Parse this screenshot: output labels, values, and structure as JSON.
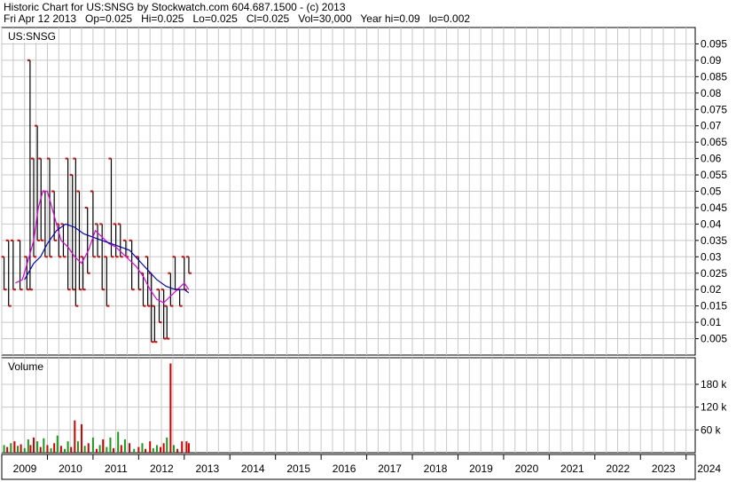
{
  "header": {
    "line1": "Historic Chart for US:SNSG by Stockwatch.com 604.687.1500 - (c) 2013",
    "line2": "Fri Apr 12 2013   Op=0.025   Hi=0.025   Lo=0.025   Cl=0.025   Vol=30,000   Year hi=0.09   lo=0.002"
  },
  "colors": {
    "background": "#ffffff",
    "grid": "#c8c8c8",
    "price_bar": "#000000",
    "price_tick": "#e00000",
    "ma_fast": "#e000e0",
    "ma_slow": "#0000c8",
    "volume_up": "#1a9a1a",
    "volume_down": "#d00000"
  },
  "chart_data": [
    {
      "type": "line",
      "title": "US:SNSG",
      "y_ticks": [
        "0.095",
        "0.09",
        "0.085",
        "0.08",
        "0.075",
        "0.07",
        "0.065",
        "0.06",
        "0.055",
        "0.05",
        "0.045",
        "0.04",
        "0.035",
        "0.03",
        "0.025",
        "0.02",
        "0.015",
        "0.01",
        "0.005"
      ],
      "ylim": [
        0,
        0.1
      ],
      "x_ticks": [
        "2009",
        "2010",
        "2011",
        "2012",
        "2013",
        "2014",
        "2015",
        "2016",
        "2017",
        "2018",
        "2019",
        "2020",
        "2021",
        "2022",
        "2023",
        "2024"
      ],
      "xlim": [
        2009,
        2024.2
      ],
      "grid": true,
      "price_bars": [
        {
          "x": 2009.05,
          "hi": 0.03,
          "lo": 0.02
        },
        {
          "x": 2009.15,
          "hi": 0.035,
          "lo": 0.015
        },
        {
          "x": 2009.25,
          "hi": 0.035,
          "lo": 0.02
        },
        {
          "x": 2009.4,
          "hi": 0.035,
          "lo": 0.02
        },
        {
          "x": 2009.55,
          "hi": 0.03,
          "lo": 0.02
        },
        {
          "x": 2009.62,
          "hi": 0.09,
          "lo": 0.02
        },
        {
          "x": 2009.7,
          "hi": 0.06,
          "lo": 0.03
        },
        {
          "x": 2009.78,
          "hi": 0.07,
          "lo": 0.035
        },
        {
          "x": 2009.86,
          "hi": 0.06,
          "lo": 0.035
        },
        {
          "x": 2009.95,
          "hi": 0.05,
          "lo": 0.03
        },
        {
          "x": 2010.05,
          "hi": 0.06,
          "lo": 0.03
        },
        {
          "x": 2010.15,
          "hi": 0.05,
          "lo": 0.035
        },
        {
          "x": 2010.25,
          "hi": 0.04,
          "lo": 0.03
        },
        {
          "x": 2010.35,
          "hi": 0.04,
          "lo": 0.03
        },
        {
          "x": 2010.45,
          "hi": 0.06,
          "lo": 0.02
        },
        {
          "x": 2010.55,
          "hi": 0.055,
          "lo": 0.02
        },
        {
          "x": 2010.62,
          "hi": 0.06,
          "lo": 0.015
        },
        {
          "x": 2010.7,
          "hi": 0.05,
          "lo": 0.02
        },
        {
          "x": 2010.78,
          "hi": 0.03,
          "lo": 0.02
        },
        {
          "x": 2010.88,
          "hi": 0.045,
          "lo": 0.025
        },
        {
          "x": 2011.0,
          "hi": 0.05,
          "lo": 0.03
        },
        {
          "x": 2011.1,
          "hi": 0.04,
          "lo": 0.03
        },
        {
          "x": 2011.2,
          "hi": 0.04,
          "lo": 0.02
        },
        {
          "x": 2011.3,
          "hi": 0.03,
          "lo": 0.015
        },
        {
          "x": 2011.4,
          "hi": 0.06,
          "lo": 0.03
        },
        {
          "x": 2011.5,
          "hi": 0.04,
          "lo": 0.03
        },
        {
          "x": 2011.6,
          "hi": 0.04,
          "lo": 0.03
        },
        {
          "x": 2011.72,
          "hi": 0.035,
          "lo": 0.03
        },
        {
          "x": 2011.85,
          "hi": 0.035,
          "lo": 0.02
        },
        {
          "x": 2012.0,
          "hi": 0.03,
          "lo": 0.02
        },
        {
          "x": 2012.1,
          "hi": 0.025,
          "lo": 0.015
        },
        {
          "x": 2012.2,
          "hi": 0.03,
          "lo": 0.015
        },
        {
          "x": 2012.28,
          "hi": 0.025,
          "lo": 0.004
        },
        {
          "x": 2012.35,
          "hi": 0.015,
          "lo": 0.004
        },
        {
          "x": 2012.45,
          "hi": 0.02,
          "lo": 0.01
        },
        {
          "x": 2012.55,
          "hi": 0.02,
          "lo": 0.005
        },
        {
          "x": 2012.62,
          "hi": 0.015,
          "lo": 0.005
        },
        {
          "x": 2012.7,
          "hi": 0.025,
          "lo": 0.015
        },
        {
          "x": 2012.8,
          "hi": 0.03,
          "lo": 0.02
        },
        {
          "x": 2012.9,
          "hi": 0.02,
          "lo": 0.015
        },
        {
          "x": 2013.0,
          "hi": 0.03,
          "lo": 0.02
        },
        {
          "x": 2013.1,
          "hi": 0.03,
          "lo": 0.025
        }
      ],
      "series": [
        {
          "values_x": [
            2009.3,
            2009.45,
            2009.6,
            2009.7,
            2009.8,
            2009.9,
            2010.0,
            2010.1,
            2010.2,
            2010.3,
            2010.45,
            2010.6,
            2010.75,
            2010.9,
            2011.05,
            2011.2,
            2011.35,
            2011.5,
            2011.65,
            2011.8,
            2011.95,
            2012.1,
            2012.25,
            2012.4,
            2012.55,
            2012.7,
            2012.85,
            2013.0,
            2013.1
          ],
          "values_y": [
            0.022,
            0.023,
            0.03,
            0.035,
            0.045,
            0.05,
            0.05,
            0.045,
            0.04,
            0.035,
            0.033,
            0.03,
            0.028,
            0.032,
            0.038,
            0.036,
            0.034,
            0.033,
            0.031,
            0.029,
            0.027,
            0.024,
            0.02,
            0.017,
            0.016,
            0.018,
            0.02,
            0.022,
            0.02
          ]
        },
        {
          "values_x": [
            2009.5,
            2009.7,
            2009.85,
            2010.0,
            2010.2,
            2010.4,
            2010.6,
            2010.8,
            2011.0,
            2011.2,
            2011.4,
            2011.6,
            2011.8,
            2012.0,
            2012.2,
            2012.4,
            2012.6,
            2012.8,
            2013.0,
            2013.1
          ],
          "values_y": [
            0.023,
            0.028,
            0.03,
            0.034,
            0.038,
            0.04,
            0.039,
            0.037,
            0.036,
            0.035,
            0.034,
            0.033,
            0.032,
            0.029,
            0.026,
            0.023,
            0.021,
            0.02,
            0.02,
            0.019
          ]
        }
      ]
    },
    {
      "type": "bar",
      "title": "Volume",
      "y_ticks": [
        "180 k",
        "120 k",
        "60 k"
      ],
      "ylim": [
        0,
        250000
      ],
      "bars": [
        {
          "x": 2009.05,
          "v": 20000,
          "up": true
        },
        {
          "x": 2009.12,
          "v": 15000,
          "up": false
        },
        {
          "x": 2009.2,
          "v": 25000,
          "up": true
        },
        {
          "x": 2009.28,
          "v": 30000,
          "up": false
        },
        {
          "x": 2009.35,
          "v": 18000,
          "up": true
        },
        {
          "x": 2009.42,
          "v": 22000,
          "up": false
        },
        {
          "x": 2009.5,
          "v": 12000,
          "up": true
        },
        {
          "x": 2009.58,
          "v": 35000,
          "up": true
        },
        {
          "x": 2009.63,
          "v": 20000,
          "up": false
        },
        {
          "x": 2009.7,
          "v": 40000,
          "up": false
        },
        {
          "x": 2009.78,
          "v": 30000,
          "up": true
        },
        {
          "x": 2009.85,
          "v": 15000,
          "up": false
        },
        {
          "x": 2009.92,
          "v": 38000,
          "up": true
        },
        {
          "x": 2010.0,
          "v": 20000,
          "up": false
        },
        {
          "x": 2010.08,
          "v": 12000,
          "up": true
        },
        {
          "x": 2010.15,
          "v": 25000,
          "up": false
        },
        {
          "x": 2010.22,
          "v": 45000,
          "up": true
        },
        {
          "x": 2010.3,
          "v": 18000,
          "up": false
        },
        {
          "x": 2010.38,
          "v": 10000,
          "up": true
        },
        {
          "x": 2010.45,
          "v": 30000,
          "up": true
        },
        {
          "x": 2010.52,
          "v": 15000,
          "up": false
        },
        {
          "x": 2010.6,
          "v": 85000,
          "up": false
        },
        {
          "x": 2010.67,
          "v": 30000,
          "up": true
        },
        {
          "x": 2010.75,
          "v": 75000,
          "up": false
        },
        {
          "x": 2010.82,
          "v": 18000,
          "up": true
        },
        {
          "x": 2010.9,
          "v": 25000,
          "up": false
        },
        {
          "x": 2011.0,
          "v": 40000,
          "up": true
        },
        {
          "x": 2011.08,
          "v": 10000,
          "up": false
        },
        {
          "x": 2011.15,
          "v": 20000,
          "up": true
        },
        {
          "x": 2011.22,
          "v": 35000,
          "up": false
        },
        {
          "x": 2011.3,
          "v": 15000,
          "up": true
        },
        {
          "x": 2011.38,
          "v": 40000,
          "up": true
        },
        {
          "x": 2011.45,
          "v": 12000,
          "up": false
        },
        {
          "x": 2011.55,
          "v": 55000,
          "up": true
        },
        {
          "x": 2011.62,
          "v": 20000,
          "up": false
        },
        {
          "x": 2011.7,
          "v": 35000,
          "up": true
        },
        {
          "x": 2011.8,
          "v": 25000,
          "up": false
        },
        {
          "x": 2011.9,
          "v": 10000,
          "up": true
        },
        {
          "x": 2012.0,
          "v": 15000,
          "up": false
        },
        {
          "x": 2012.08,
          "v": 25000,
          "up": true
        },
        {
          "x": 2012.15,
          "v": 10000,
          "up": false
        },
        {
          "x": 2012.25,
          "v": 30000,
          "up": false
        },
        {
          "x": 2012.32,
          "v": 12000,
          "up": true
        },
        {
          "x": 2012.4,
          "v": 20000,
          "up": true
        },
        {
          "x": 2012.48,
          "v": 15000,
          "up": false
        },
        {
          "x": 2012.55,
          "v": 25000,
          "up": false
        },
        {
          "x": 2012.62,
          "v": 40000,
          "up": true
        },
        {
          "x": 2012.7,
          "v": 235000,
          "up": false
        },
        {
          "x": 2012.77,
          "v": 20000,
          "up": true
        },
        {
          "x": 2012.85,
          "v": 10000,
          "up": false
        },
        {
          "x": 2012.95,
          "v": 30000,
          "up": false
        },
        {
          "x": 2013.05,
          "v": 30000,
          "up": false
        },
        {
          "x": 2013.1,
          "v": 25000,
          "up": false
        }
      ]
    }
  ]
}
